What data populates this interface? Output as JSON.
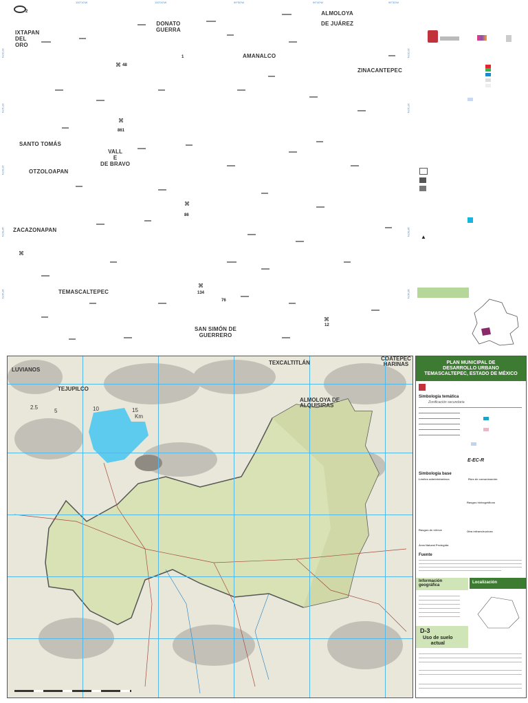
{
  "top_map": {
    "municipalities": [
      {
        "id": "ixtapan",
        "lines": [
          "IXTAPAN",
          "DEL",
          "ORO"
        ]
      },
      {
        "id": "donato",
        "lines": [
          "DONATO",
          "GUERRA"
        ]
      },
      {
        "id": "almoloya",
        "lines": [
          "ALMOLOYA",
          "DE JUÁREZ"
        ]
      },
      {
        "id": "amanalco",
        "lines": [
          "AMANALCO"
        ]
      },
      {
        "id": "zinacantepec",
        "lines": [
          "ZINACANTEPEC"
        ]
      },
      {
        "id": "santo-tomas",
        "lines": [
          "SANTO TOMÁS"
        ]
      },
      {
        "id": "valle",
        "lines": [
          "VALL",
          "E",
          "DE BRAVO"
        ]
      },
      {
        "id": "otzoloapan",
        "lines": [
          "OTZOLOAPAN"
        ]
      },
      {
        "id": "zacazonapan",
        "lines": [
          "ZACAZONAPAN"
        ]
      },
      {
        "id": "temascaltepec",
        "lines": [
          "TEMASCALTEPEC"
        ]
      },
      {
        "id": "san-simon",
        "lines": [
          "SAN SIMÓN DE",
          "GUERRERO"
        ]
      }
    ],
    "road_numbers": [
      "2",
      "48",
      "1",
      "861",
      "86",
      "134",
      "76",
      "12"
    ]
  },
  "main_map": {
    "labels": [
      "LUVIANOS",
      "TEJUPILCO",
      "TEXCALTITLÁN",
      "COATEPEC HARINAS",
      "ALMOLOYA DE ALQUISIRAS"
    ],
    "scale": [
      "2.5",
      "5",
      "10",
      "15",
      "Km"
    ]
  },
  "cartouche": {
    "title_lines": [
      "PLAN MUNICIPAL DE",
      "DESARROLLO URBANO",
      "TEMASCALTEPEC, ESTADO DE MÉXICO"
    ],
    "simbologia_tematica": "Simbología temática",
    "zonificacion": "Zonificación secundaria",
    "code": "E-EC-R",
    "simbologia_base": "Simbología base",
    "limites": "Límites administrativos",
    "rios": "Ríos de comunicación",
    "rasgos": "Rasgos hidrográficos",
    "rasgos_relieve": "Rasgos de relieve",
    "otra_infra": "Otra infraestructura",
    "anp": "Área Natural Protegida",
    "fuente": "Fuente",
    "info_geo": [
      "Información",
      "geográfica"
    ],
    "localizacion": "Localización",
    "sheet": "D-3",
    "uso_suelo": [
      "Uso de suelo",
      "actual"
    ]
  }
}
